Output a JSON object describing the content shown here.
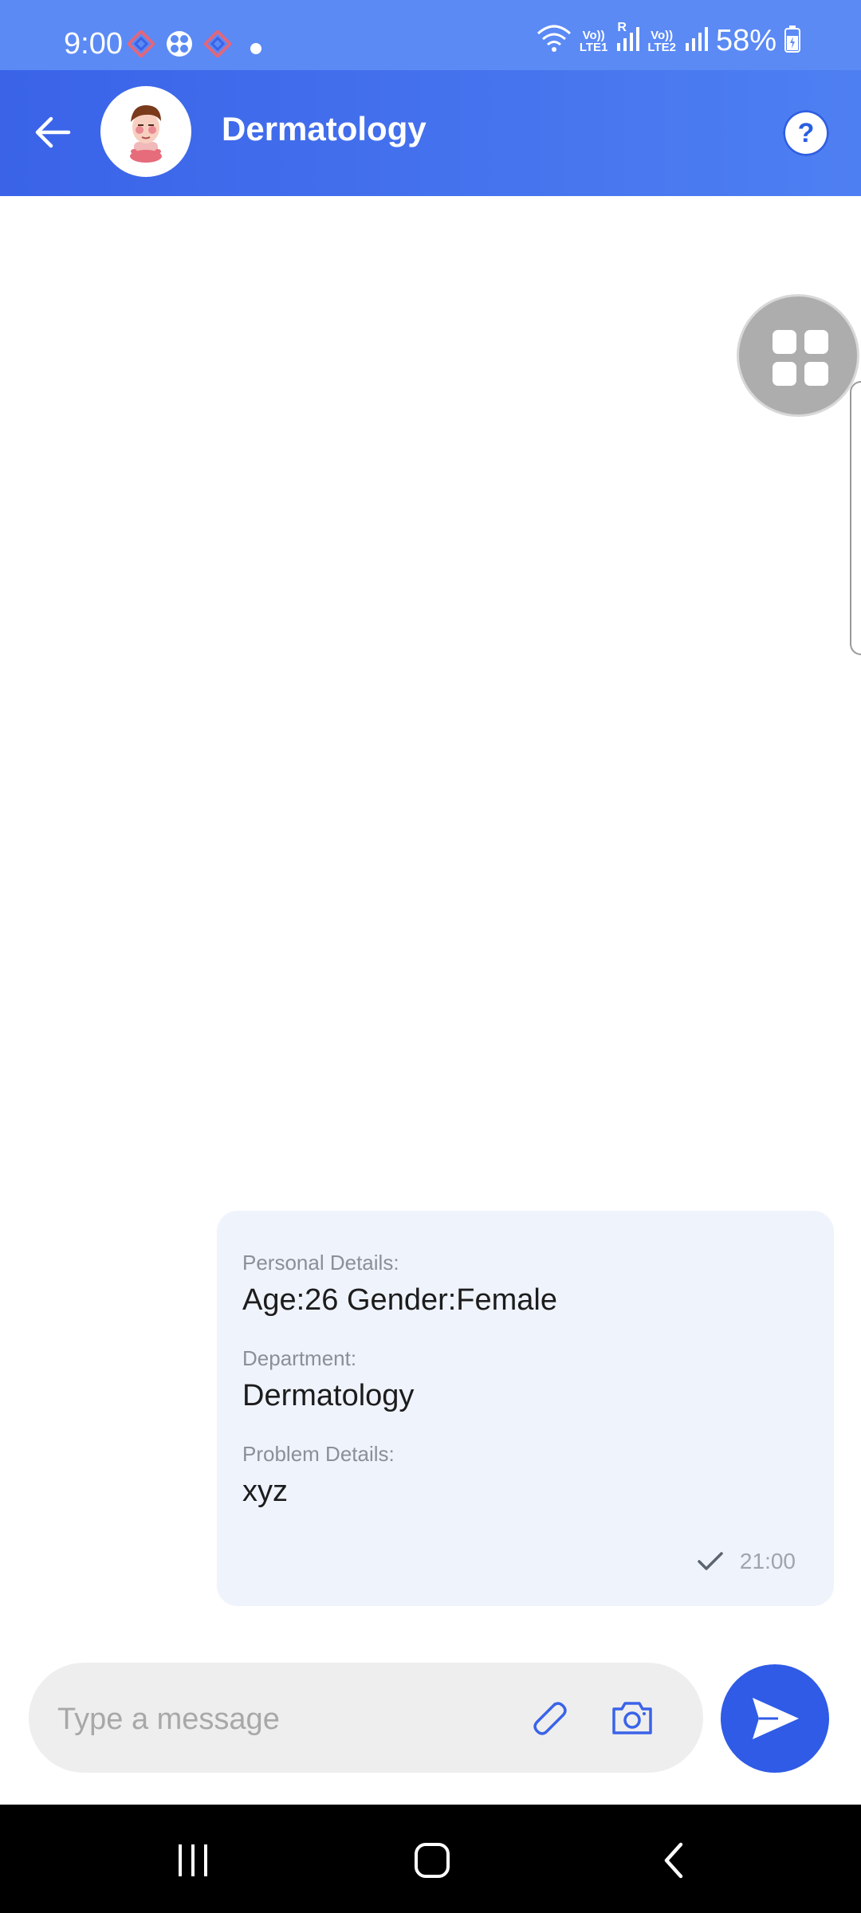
{
  "status_bar": {
    "time": "9:00",
    "net1": {
      "top": "Vo))",
      "bottom": "LTE1"
    },
    "roaming": "R",
    "net2": {
      "top": "Vo))",
      "bottom": "LTE2"
    },
    "battery": "58%",
    "icons": [
      "notification-app-icon",
      "fan-app-icon",
      "wifi-icon",
      "signal-icon",
      "battery-icon"
    ]
  },
  "header": {
    "title": "Dermatology",
    "help_label": "?",
    "icons": [
      "back-arrow-icon",
      "doctor-avatar",
      "help-icon"
    ]
  },
  "message": {
    "sections": [
      {
        "label": "Personal Details:",
        "value": "Age:26 Gender:Female"
      },
      {
        "label": "Department:",
        "value": "Dermatology"
      },
      {
        "label": "Problem Details:",
        "value": "xyz"
      }
    ],
    "time": "21:00",
    "status_icon": "check-icon"
  },
  "composer": {
    "placeholder": "Type a message",
    "icons": [
      "paperclip-icon",
      "camera-icon",
      "send-icon"
    ]
  },
  "colors": {
    "primary": "#3a63e8",
    "status_bar": "#5b8af5",
    "bubble": "#eff3fc",
    "send": "#2f5be6"
  }
}
